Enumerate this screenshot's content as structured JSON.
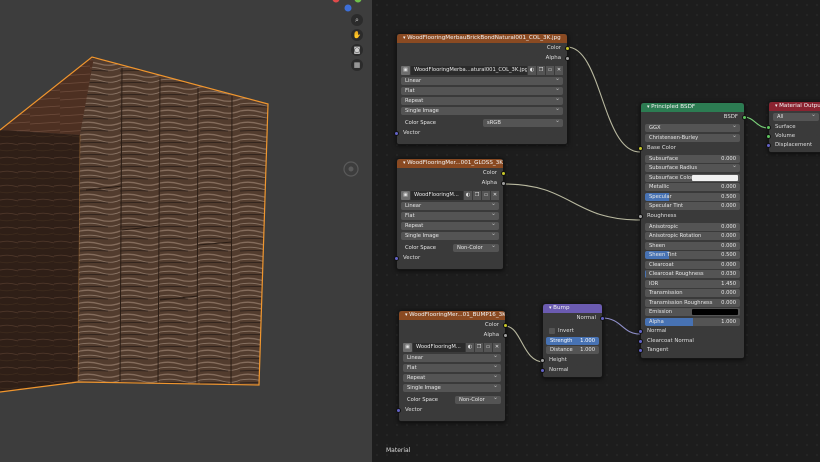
{
  "viewport": {
    "tools": [
      {
        "icon": "zoom-icon",
        "glyph": "⌕"
      },
      {
        "icon": "hand-pan-icon",
        "glyph": "✋"
      },
      {
        "icon": "camera-icon",
        "glyph": "◙"
      },
      {
        "icon": "grid-icon",
        "glyph": "▦"
      }
    ],
    "gizmo_colors": {
      "x": "#e04a4a",
      "y": "#70c04a",
      "z": "#3d6fd8"
    }
  },
  "editor": {
    "label": "Material"
  },
  "nodes": {
    "tex1": {
      "title": "WoodFlooringMerbauBrickBondNatural001_COL_3K.jpg",
      "outputs": [
        "Color",
        "Alpha"
      ],
      "image_name": "WoodFlooringMerba...atural001_COL_3K.jpg",
      "interpolation": "Linear",
      "projection": "Flat",
      "extension": "Repeat",
      "source": "Single Image",
      "color_space_label": "Color Space",
      "color_space": "sRGB",
      "input": "Vector"
    },
    "tex2": {
      "title": "WoodFlooringMer...001_GLOSS_3K.jpg",
      "outputs": [
        "Color",
        "Alpha"
      ],
      "image_name": "WoodFlooringM...",
      "interpolation": "Linear",
      "projection": "Flat",
      "extension": "Repeat",
      "source": "Single Image",
      "color_space_label": "Color Space",
      "color_space": "Non-Color",
      "input": "Vector"
    },
    "tex3": {
      "title": "WoodFlooringMer...01_BUMP16_3K.tif",
      "outputs": [
        "Color",
        "Alpha"
      ],
      "image_name": "WoodFlooringM...",
      "interpolation": "Linear",
      "projection": "Flat",
      "extension": "Repeat",
      "source": "Single Image",
      "color_space_label": "Color Space",
      "color_space": "Non-Color",
      "input": "Vector"
    },
    "bump": {
      "title": "Bump",
      "output": "Normal",
      "invert_label": "Invert",
      "strength_label": "Strength",
      "strength": "1.000",
      "distance_label": "Distance",
      "distance": "1.000",
      "inputs": [
        "Height",
        "Normal"
      ]
    },
    "bsdf": {
      "title": "Principled BSDF",
      "output": "BSDF",
      "distribution": "GGX",
      "subsurface_method": "Christensen-Burley",
      "base_color": "Base Color",
      "fields": [
        {
          "label": "Subsurface",
          "value": "0.000",
          "fill": 0
        },
        {
          "label": "Subsurface Radius",
          "value": "",
          "type": "dropdown"
        },
        {
          "label": "Subsurface Color",
          "value": "",
          "type": "color",
          "color": "#f2f2f2"
        },
        {
          "label": "Metallic",
          "value": "0.000",
          "fill": 0
        },
        {
          "label": "Specular",
          "value": "0.500",
          "fill": 0.5
        },
        {
          "label": "Specular Tint",
          "value": "0.000",
          "fill": 0
        },
        {
          "label": "Roughness",
          "value": "",
          "type": "socket"
        },
        {
          "label": "Anisotropic",
          "value": "0.000",
          "fill": 0
        },
        {
          "label": "Anisotropic Rotation",
          "value": "0.000",
          "fill": 0
        },
        {
          "label": "Sheen",
          "value": "0.000",
          "fill": 0
        },
        {
          "label": "Sheen Tint",
          "value": "0.500",
          "fill": 0.5
        },
        {
          "label": "Clearcoat",
          "value": "0.000",
          "fill": 0
        },
        {
          "label": "Clearcoat Roughness",
          "value": "0.030",
          "fill": 0.03
        },
        {
          "label": "IOR",
          "value": "1.450",
          "fill": 0
        },
        {
          "label": "Transmission",
          "value": "0.000",
          "fill": 0
        },
        {
          "label": "Transmission Roughness",
          "value": "0.000",
          "fill": 0
        },
        {
          "label": "Emission",
          "value": "",
          "type": "color",
          "color": "#000000"
        },
        {
          "label": "Alpha",
          "value": "1.000",
          "fill": 1
        }
      ],
      "inputs_tail": [
        "Normal",
        "Clearcoat Normal",
        "Tangent"
      ]
    },
    "output": {
      "title": "Material Output",
      "target": "All",
      "inputs": [
        "Surface",
        "Volume",
        "Displacement"
      ]
    }
  }
}
